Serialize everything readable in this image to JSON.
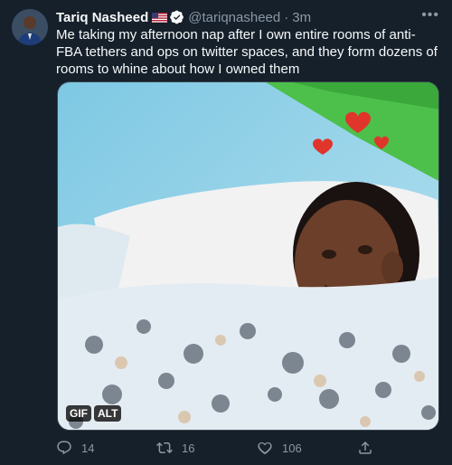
{
  "author": {
    "name": "Tariq Nasheed",
    "handle": "@tariqnasheed",
    "separator": "·",
    "time": "3m"
  },
  "tweet": {
    "text": "Me taking my afternoon nap after I own entire rooms of anti-FBA tethers and ops on twitter spaces, and they form dozens of rooms to whine about how I owned them"
  },
  "media": {
    "gif_badge": "GIF",
    "alt_badge": "ALT"
  },
  "actions": {
    "replies": "14",
    "retweets": "16",
    "likes": "106"
  },
  "icons": [
    "flag-usa-icon",
    "verified-badge-icon",
    "more-icon",
    "reply-icon",
    "retweet-icon",
    "like-icon",
    "share-icon"
  ],
  "colors": {
    "background": "#15202b",
    "text": "#f7f9f9",
    "secondary": "#8b98a5",
    "verified": "#1d9bf0"
  }
}
